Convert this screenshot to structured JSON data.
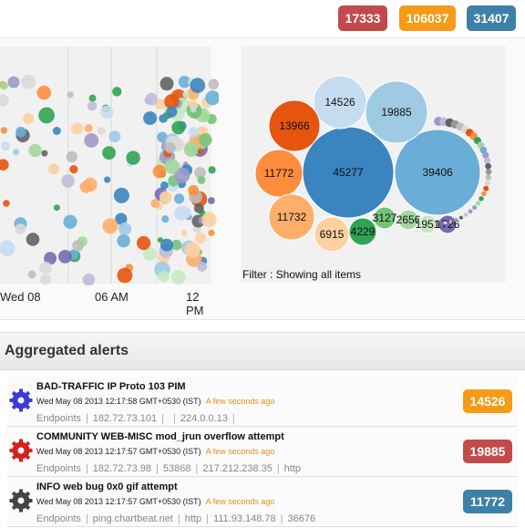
{
  "top_badges": [
    {
      "value": "17333",
      "color": "#c24a4a"
    },
    {
      "value": "106037",
      "color": "#f59b18"
    },
    {
      "value": "31407",
      "color": "#3d80a8"
    }
  ],
  "timeline": {
    "x_tick_labels": [
      "Wed 08",
      "06 AM",
      "12 PM"
    ]
  },
  "bubble_chart": {
    "bubbles": [
      {
        "label": "45277",
        "color": "#3a85bf"
      },
      {
        "label": "39406",
        "color": "#6aaed8"
      },
      {
        "label": "19885",
        "color": "#9fcae4"
      },
      {
        "label": "14526",
        "color": "#c6ddf0"
      },
      {
        "label": "13966",
        "color": "#e6550d"
      },
      {
        "label": "11772",
        "color": "#fd8d3c"
      },
      {
        "label": "11732",
        "color": "#fdae6b"
      },
      {
        "label": "6915",
        "color": "#fdd0a2"
      },
      {
        "label": "4229",
        "color": "#31a354"
      },
      {
        "label": "3127",
        "color": "#74c476"
      },
      {
        "label": "2656",
        "color": "#a1d99b"
      },
      {
        "label": "1951",
        "color": "#c7e9c0"
      },
      {
        "label": "1726",
        "color": "#756bb1"
      }
    ],
    "filter_text": "Filter : Showing all items"
  },
  "alerts": {
    "title": "Aggregated alerts",
    "items": [
      {
        "name": "BAD-TRAFFIC IP Proto 103 PIM",
        "time": "Wed May 08 2013 12:17:58 GMT+0530 (IST)",
        "ago": "A few seconds ago",
        "endpoints_label": "Endpoints",
        "endpoints": [
          "182.72.73.101",
          "",
          "224.0.0.13",
          ""
        ],
        "count": "14526",
        "count_color": "#f59b18",
        "icon": "gear-icon",
        "icon_color": "#3b3bdc"
      },
      {
        "name": "COMMUNITY WEB-MISC mod_jrun overflow attempt",
        "time": "Wed May 08 2013 12:17:57 GMT+0530 (IST)",
        "ago": "A few seconds ago",
        "endpoints_label": "Endpoints",
        "endpoints": [
          "182.72.73.98",
          "53868",
          "217.212.238.35",
          "http"
        ],
        "count": "19885",
        "count_color": "#c24a4a",
        "icon": "gear-icon",
        "icon_color": "#d62020"
      },
      {
        "name": "INFO web bug 0x0 gif attempt",
        "time": "Wed May 08 2013 12:17:57 GMT+0530 (IST)",
        "ago": "A few seconds ago",
        "endpoints_label": "Endpoints",
        "endpoints": [
          "ping.chartbeat.net",
          "http",
          "111.93.148.78",
          "36676"
        ],
        "count": "11772",
        "count_color": "#3d80a8",
        "icon": "gear-icon",
        "icon_color": "#444444"
      }
    ]
  }
}
